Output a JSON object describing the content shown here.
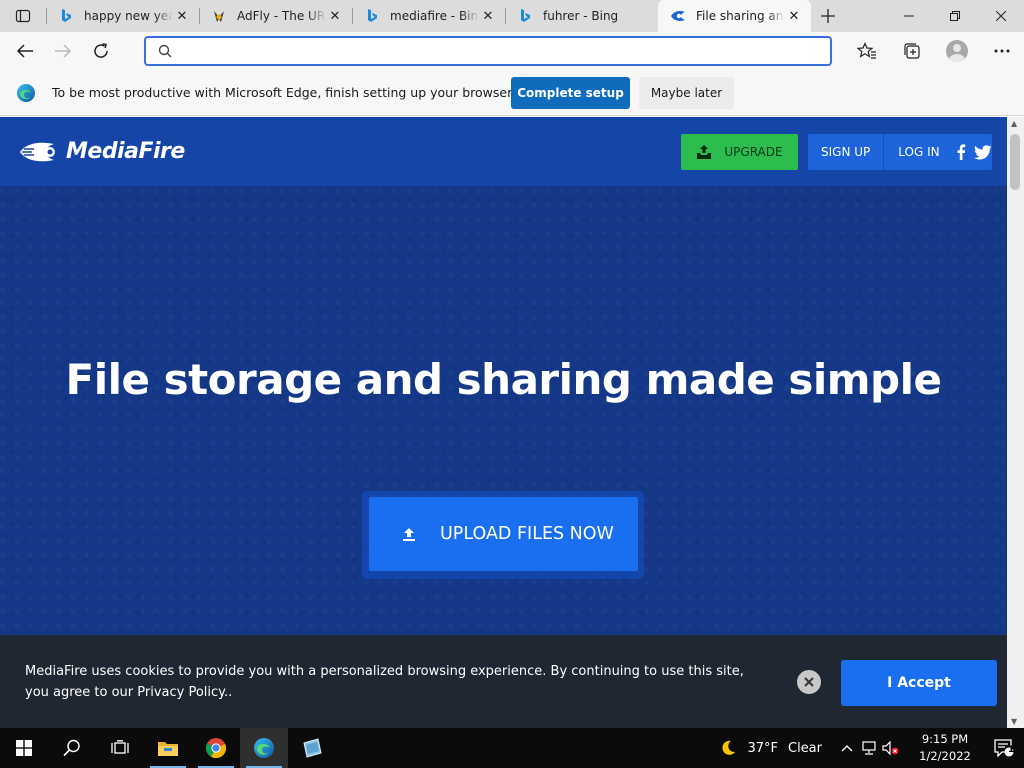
{
  "browser": {
    "tabs": [
      {
        "title": "happy new year",
        "favicon": "bing-icon",
        "active": false
      },
      {
        "title": "AdFly - The URL",
        "favicon": "adfly-icon",
        "active": false
      },
      {
        "title": "mediafire - Bing",
        "favicon": "bing-icon",
        "active": false
      },
      {
        "title": "fuhrer - Bing",
        "favicon": "bing-icon",
        "active": false
      },
      {
        "title": "File sharing and",
        "favicon": "mediafire-icon",
        "active": true
      }
    ],
    "address": {
      "value": "",
      "placeholder": ""
    },
    "infobar": {
      "message": "To be most productive with Microsoft Edge, finish setting up your browser.",
      "primary": "Complete setup",
      "secondary": "Maybe later"
    }
  },
  "site": {
    "logo": "MediaFire",
    "nav": {
      "upgrade": "UPGRADE",
      "signup": "SIGN UP",
      "login": "LOG IN"
    },
    "hero": {
      "title": "File storage and sharing made simple",
      "upload": "UPLOAD FILES NOW"
    },
    "cookie": {
      "text": "MediaFire uses cookies to provide you with a personalized browsing experience. By continuing to use this site, you agree to our Privacy Policy..",
      "accept": "I Accept"
    }
  },
  "taskbar": {
    "weather": {
      "temp": "37°F",
      "condition": "Clear"
    },
    "clock": {
      "time": "9:15 PM",
      "date": "1/2/2022"
    },
    "notifications": "1"
  },
  "colors": {
    "accent": "#0f6cbd",
    "mediafire_blue": "#1645a8",
    "upgrade_green": "#2dbc4e",
    "page_bg": "#143887"
  }
}
